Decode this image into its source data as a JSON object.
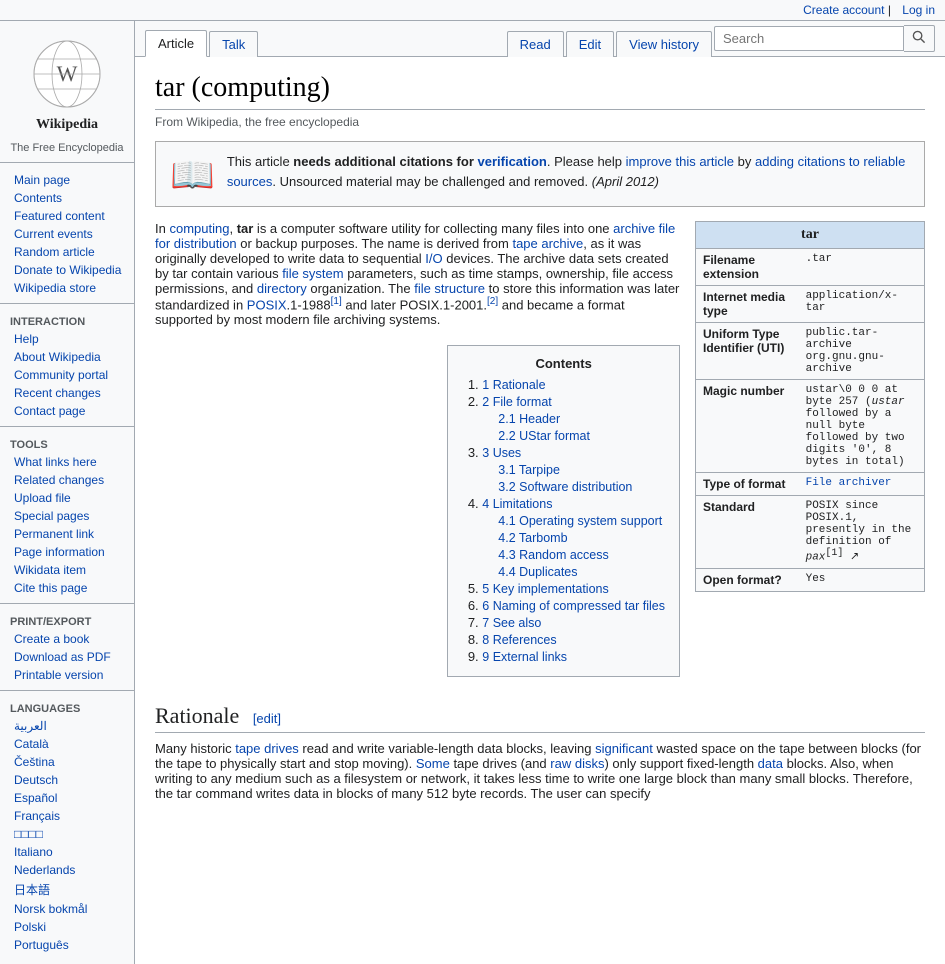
{
  "topbar": {
    "create_account": "Create account",
    "log_in": "Log in"
  },
  "sidebar": {
    "logo_alt": "Wikipedia",
    "title": "Wikipedia",
    "subtitle": "The Free Encyclopedia",
    "nav_items": [
      {
        "id": "main-page",
        "label": "Main page"
      },
      {
        "id": "contents",
        "label": "Contents"
      },
      {
        "id": "featured-content",
        "label": "Featured content"
      },
      {
        "id": "current-events",
        "label": "Current events"
      },
      {
        "id": "random-article",
        "label": "Random article"
      },
      {
        "id": "donate",
        "label": "Donate to Wikipedia"
      },
      {
        "id": "wikipedia-store",
        "label": "Wikipedia store"
      }
    ],
    "interaction_title": "Interaction",
    "interaction_items": [
      {
        "id": "help",
        "label": "Help"
      },
      {
        "id": "about-wikipedia",
        "label": "About Wikipedia"
      },
      {
        "id": "community-portal",
        "label": "Community portal"
      },
      {
        "id": "recent-changes",
        "label": "Recent changes"
      },
      {
        "id": "contact-page",
        "label": "Contact page"
      }
    ],
    "tools_title": "Tools",
    "tools_items": [
      {
        "id": "what-links-here",
        "label": "What links here"
      },
      {
        "id": "related-changes",
        "label": "Related changes"
      },
      {
        "id": "upload-file",
        "label": "Upload file"
      },
      {
        "id": "special-pages",
        "label": "Special pages"
      },
      {
        "id": "permanent-link",
        "label": "Permanent link"
      },
      {
        "id": "page-information",
        "label": "Page information"
      },
      {
        "id": "wikidata-item",
        "label": "Wikidata item"
      },
      {
        "id": "cite-this-page",
        "label": "Cite this page"
      }
    ],
    "print_title": "Print/export",
    "print_items": [
      {
        "id": "create-book",
        "label": "Create a book"
      },
      {
        "id": "download-pdf",
        "label": "Download as PDF"
      },
      {
        "id": "printable-version",
        "label": "Printable version"
      }
    ],
    "languages_title": "Languages",
    "language_items": [
      {
        "id": "arabic",
        "label": "العربية"
      },
      {
        "id": "catala",
        "label": "Català"
      },
      {
        "id": "cestina",
        "label": "Čeština"
      },
      {
        "id": "deutsch",
        "label": "Deutsch"
      },
      {
        "id": "espanol",
        "label": "Español"
      },
      {
        "id": "francais",
        "label": "Français"
      },
      {
        "id": "japanese-kana",
        "label": "□□□□"
      },
      {
        "id": "italiano",
        "label": "Italiano"
      },
      {
        "id": "nederlands",
        "label": "Nederlands"
      },
      {
        "id": "japanese",
        "label": "日本語"
      },
      {
        "id": "norwegian",
        "label": "Norsk bokmål"
      },
      {
        "id": "polish",
        "label": "Polski"
      },
      {
        "id": "portuguese",
        "label": "Português"
      }
    ]
  },
  "tabs": {
    "article": "Article",
    "talk": "Talk",
    "read": "Read",
    "edit": "Edit",
    "view_history": "View history"
  },
  "search": {
    "placeholder": "Search",
    "button_label": "🔍"
  },
  "article": {
    "title": "tar (computing)",
    "subtitle": "From Wikipedia, the free encyclopedia",
    "notice": {
      "icon": "📖",
      "text_before": "This article ",
      "emphasis": "needs additional citations for ",
      "emphasis_link": "verification",
      "text_after": ". Please help ",
      "improve_link": "improve this article",
      "text_middle": " by ",
      "adding_link": "adding citations to reliable sources",
      "text_end": ". Unsourced material may be challenged and removed.",
      "date": "(April 2012)"
    },
    "infobox": {
      "title": "tar",
      "rows": [
        {
          "label": "Filename extension",
          "value": ".tar"
        },
        {
          "label": "Internet media type",
          "value": "application/x-tar"
        },
        {
          "label": "Uniform Type Identifier (UTI)",
          "value": "public.tar-archive org.gnu.gnu-archive"
        },
        {
          "label": "Magic number",
          "value": "ustar\\0 0 0 at byte 257 (ustar followed by a null byte followed by two digits '0', 8 bytes in total)"
        },
        {
          "label": "Type of format",
          "value": "File archiver"
        },
        {
          "label": "Standard",
          "value": "POSIX since POSIX.1, presently in the definition of pax[1]"
        },
        {
          "label": "Open format?",
          "value": "Yes"
        }
      ]
    },
    "intro": "In computing, tar is a computer software utility for collecting many files into one archive file for distribution or backup purposes. The name is derived from tape archive, as it was originally developed to write data to sequential I/O devices. The archive data sets created by tar contain various file system parameters, such as time stamps, ownership, file access permissions, and directory organization. The file structure to store this information was later standardized in POSIX.1-1988[1] and later POSIX.1-2001.[2] and became a format supported by most modern file archiving systems.",
    "toc": {
      "title": "Contents",
      "items": [
        {
          "num": "1",
          "label": "Rationale",
          "id": "rationale"
        },
        {
          "num": "2",
          "label": "File format",
          "id": "file-format",
          "subitems": [
            {
              "num": "2.1",
              "label": "Header",
              "id": "header"
            },
            {
              "num": "2.2",
              "label": "UStar format",
              "id": "ustar-format"
            }
          ]
        },
        {
          "num": "3",
          "label": "Uses",
          "id": "uses",
          "subitems": [
            {
              "num": "3.1",
              "label": "Tarpipe",
              "id": "tarpipe"
            },
            {
              "num": "3.2",
              "label": "Software distribution",
              "id": "software-distribution"
            }
          ]
        },
        {
          "num": "4",
          "label": "Limitations",
          "id": "limitations",
          "subitems": [
            {
              "num": "4.1",
              "label": "Operating system support",
              "id": "os-support"
            },
            {
              "num": "4.2",
              "label": "Tarbomb",
              "id": "tarbomb"
            },
            {
              "num": "4.3",
              "label": "Random access",
              "id": "random-access"
            },
            {
              "num": "4.4",
              "label": "Duplicates",
              "id": "duplicates"
            }
          ]
        },
        {
          "num": "5",
          "label": "Key implementations",
          "id": "key-implementations"
        },
        {
          "num": "6",
          "label": "Naming of compressed tar files",
          "id": "naming"
        },
        {
          "num": "7",
          "label": "See also",
          "id": "see-also"
        },
        {
          "num": "8",
          "label": "References",
          "id": "references"
        },
        {
          "num": "9",
          "label": "External links",
          "id": "external-links"
        }
      ]
    },
    "sections": [
      {
        "id": "rationale",
        "title": "Rationale",
        "edit_label": "[edit]",
        "content": "Many historic tape drives read and write variable-length data blocks, leaving significant wasted space on the tape between blocks (for the tape to physically start and stop moving). Some tape drives (and raw disks) only support fixed-length data blocks. Also, when writing to any medium such as a filesystem or network, it takes less time to write one large block than many small blocks. Therefore, the tar command writes data in blocks of many 512 byte records. The user can specify"
      }
    ]
  }
}
